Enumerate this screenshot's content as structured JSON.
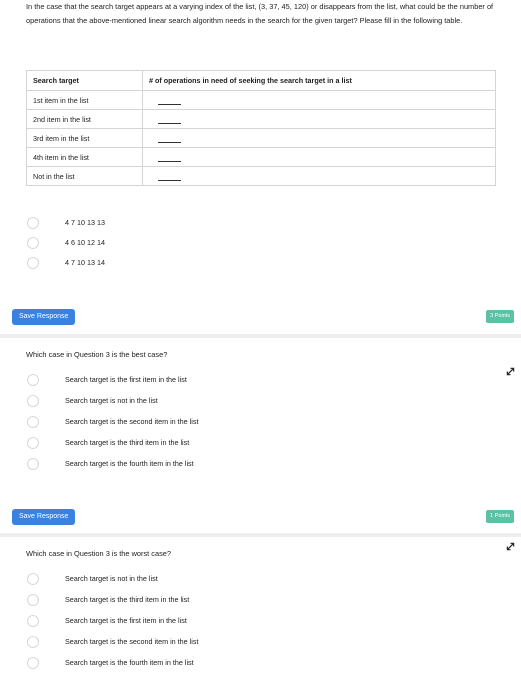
{
  "question_intro": "In the case that the search target appears at a varying index of the list, (3, 37, 45, 120) or disappears from the list, what could be the number of operations that the above-mentioned linear search algorithm needs in the search for the given target? Please fill in the following table.",
  "table": {
    "headers": [
      "Search target",
      "# of operations in need of seeking the search target in a list"
    ],
    "rows": [
      "1st item in the list",
      "2nd item in the list",
      "3rd item in the list",
      "4th item in the list",
      "Not in the list"
    ]
  },
  "q1": {
    "options": [
      "4 7 10 13 13",
      "4 6 10 12 14",
      "4 7 10 13 14"
    ],
    "save_label": "Save Response",
    "points": "3 Points"
  },
  "q2": {
    "title": "Which case in Question 3 is the best case?",
    "options": [
      "Search target is the first item in the list",
      "Search target is not in the list",
      "Search target is the second item in the list",
      "Search target is the third item in the list",
      "Search target is the fourth item in the list"
    ],
    "save_label": "Save Response",
    "points": "1 Points"
  },
  "q3": {
    "title": "Which case in Question 3 is the worst case?",
    "options": [
      "Search target is not in the list",
      "Search target is the third item in the list",
      "Search target is the first item in the list",
      "Search target is the second item in the list",
      "Search target is the fourth item in the list"
    ]
  }
}
